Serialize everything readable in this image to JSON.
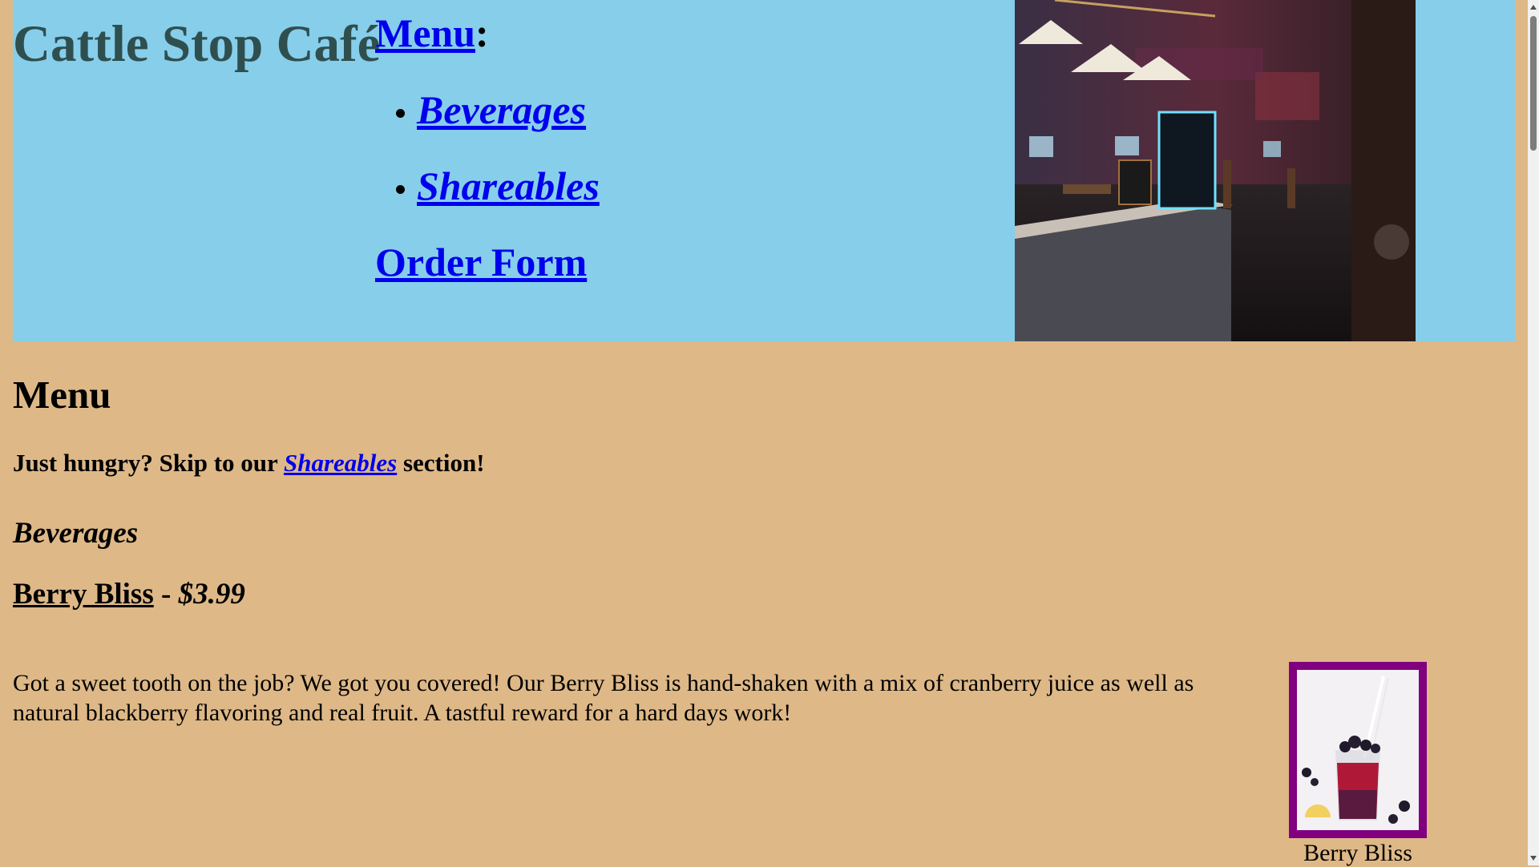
{
  "header": {
    "site_title": "Cattle Stop Café",
    "nav": {
      "menu_link": "Menu",
      "menu_colon": ":",
      "items": [
        {
          "label": "Beverages"
        },
        {
          "label": "Shareables"
        }
      ],
      "order_form": "Order Form"
    }
  },
  "main": {
    "heading": "Menu",
    "skip": {
      "before": "Just hungry? Skip to our ",
      "link": "Shareables",
      "after": " section!"
    },
    "section_title": "Beverages",
    "item": {
      "name": "Berry Bliss",
      "separator": " - ",
      "price": "$3.99",
      "description": "Got a sweet tooth on the job? We got you covered! Our Berry Bliss is hand-shaken with a mix of cranberry juice as well as natural blackberry flavoring and real fruit. A tastful reward for a hard days work!",
      "caption": "Berry Bliss"
    }
  },
  "colors": {
    "page_background": "#deb887",
    "header_background": "#87ceeb",
    "title_color": "#2f4f4f",
    "link_color": "#0000ee",
    "photo_border": "#800080"
  }
}
